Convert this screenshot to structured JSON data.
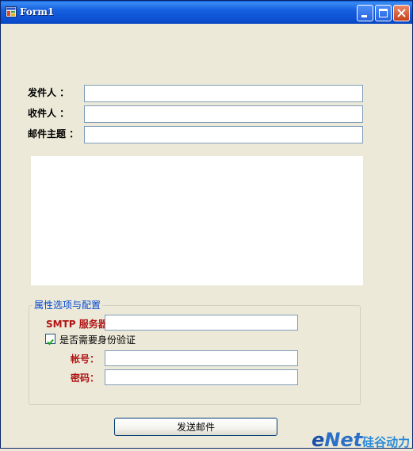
{
  "window": {
    "title": "Form1"
  },
  "form": {
    "sender_label": "发件人 ：",
    "sender_value": "",
    "recipient_label": "收件人 ：",
    "recipient_value": "",
    "subject_label": "邮件主题 ：",
    "subject_value": "",
    "body_value": ""
  },
  "group": {
    "title": "属性选项与配置",
    "smtp_label": "SMTP 服务器:",
    "smtp_value": "",
    "auth_checkbox_label": "是否需要身份验证",
    "auth_checked": true,
    "account_label": "帐号：",
    "account_value": "",
    "password_label": "密码：",
    "password_value": ""
  },
  "actions": {
    "send_label": "发送邮件"
  },
  "watermark": {
    "e": "e",
    "net": "Net",
    "cn": "硅谷动力"
  },
  "icons": {
    "app": "app-form-icon",
    "minimize": "minimize-icon",
    "maximize": "maximize-icon",
    "close": "close-icon",
    "check": "checkmark-icon"
  },
  "colors": {
    "titlebar": "#0b4fd0",
    "window_bg": "#ece9d8",
    "label_red": "#b01414",
    "group_title": "#0046d5"
  }
}
